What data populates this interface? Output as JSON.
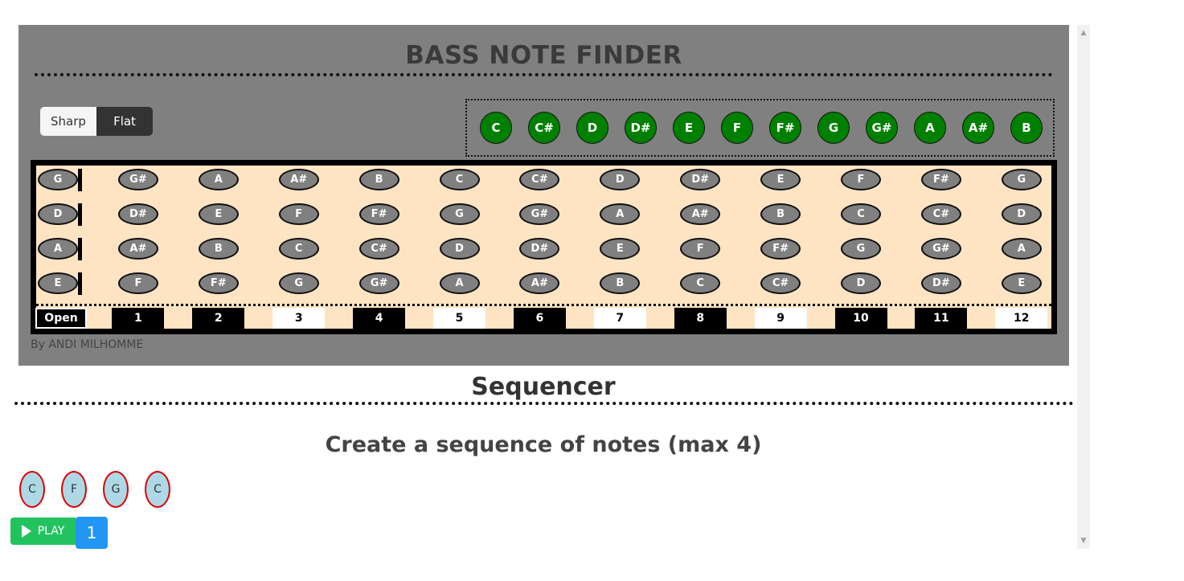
{
  "app": {
    "title": "BASS NOTE FINDER",
    "byline": "By ANDI MILHOMME"
  },
  "accidental_toggle": {
    "sharp_label": "Sharp",
    "flat_label": "Flat",
    "selected": "Flat"
  },
  "palette": {
    "notes": [
      "C",
      "C#",
      "D",
      "D#",
      "E",
      "F",
      "F#",
      "G",
      "G#",
      "A",
      "A#",
      "B"
    ],
    "color": "#008000"
  },
  "fretboard": {
    "strings": [
      [
        "G",
        "G#",
        "A",
        "A#",
        "B",
        "C",
        "C#",
        "D",
        "D#",
        "E",
        "F",
        "F#",
        "G"
      ],
      [
        "D",
        "D#",
        "E",
        "F",
        "F#",
        "G",
        "G#",
        "A",
        "A#",
        "B",
        "C",
        "C#",
        "D"
      ],
      [
        "A",
        "A#",
        "B",
        "C",
        "C#",
        "D",
        "D#",
        "E",
        "F",
        "F#",
        "G",
        "G#",
        "A"
      ],
      [
        "E",
        "F",
        "F#",
        "G",
        "G#",
        "A",
        "A#",
        "B",
        "C",
        "C#",
        "D",
        "D#",
        "E"
      ]
    ],
    "fret_labels": [
      "Open",
      "1",
      "2",
      "3",
      "4",
      "5",
      "6",
      "7",
      "8",
      "9",
      "10",
      "11",
      "12"
    ],
    "marked_frets": [
      0,
      1,
      2,
      4,
      6,
      8,
      10,
      11
    ],
    "background_color": "#ffe4c4",
    "note_color": "#808080"
  },
  "sequencer": {
    "title": "Sequencer",
    "subtitle": "Create a sequence of notes (max 4)",
    "notes": [
      "C",
      "F",
      "G",
      "C"
    ],
    "play_label": "PLAY",
    "counter": "1"
  },
  "colors": {
    "panel": "#808080",
    "play": "#22c35e",
    "counter": "#2196f3"
  },
  "scrollbar": {
    "up_icon": "chevron-up-icon",
    "down_icon": "chevron-down-icon"
  }
}
